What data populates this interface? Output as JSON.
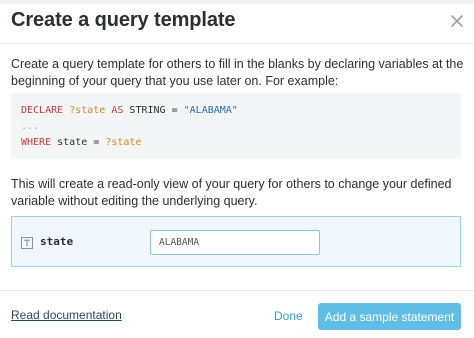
{
  "dialog": {
    "title": "Create a query template",
    "close_icon": "close-icon"
  },
  "intro_text": "Create a query template for others to fill in the blanks by declaring variables at the beginning of your query that you use later on. For example:",
  "code_example": {
    "line1": {
      "kw_declare": "DECLARE",
      "variable": "?state",
      "kw_as": "AS",
      "type": "STRING",
      "equals": "=",
      "value": "\"ALABAMA\""
    },
    "line2": "...",
    "line3": {
      "kw_where": "WHERE",
      "column": "state",
      "equals": "=",
      "variable": "?state"
    }
  },
  "description": "This will create a read-only view of your query for others to change your defined variable without editing the underlying query.",
  "variable_row": {
    "type_icon": "text-type-icon",
    "name": "state",
    "value": "ALABAMA"
  },
  "footer": {
    "doc_link": "Read documentation",
    "done_label": "Done",
    "primary_label": "Add a sample statement"
  },
  "colors": {
    "accent": "#60bde6",
    "link": "#3b97cf",
    "panel_bg": "#f1f8fd",
    "panel_border": "#9fd0ef",
    "keyword": "#c63f3f",
    "variable": "#d98a1f",
    "string": "#2b6cb0"
  }
}
